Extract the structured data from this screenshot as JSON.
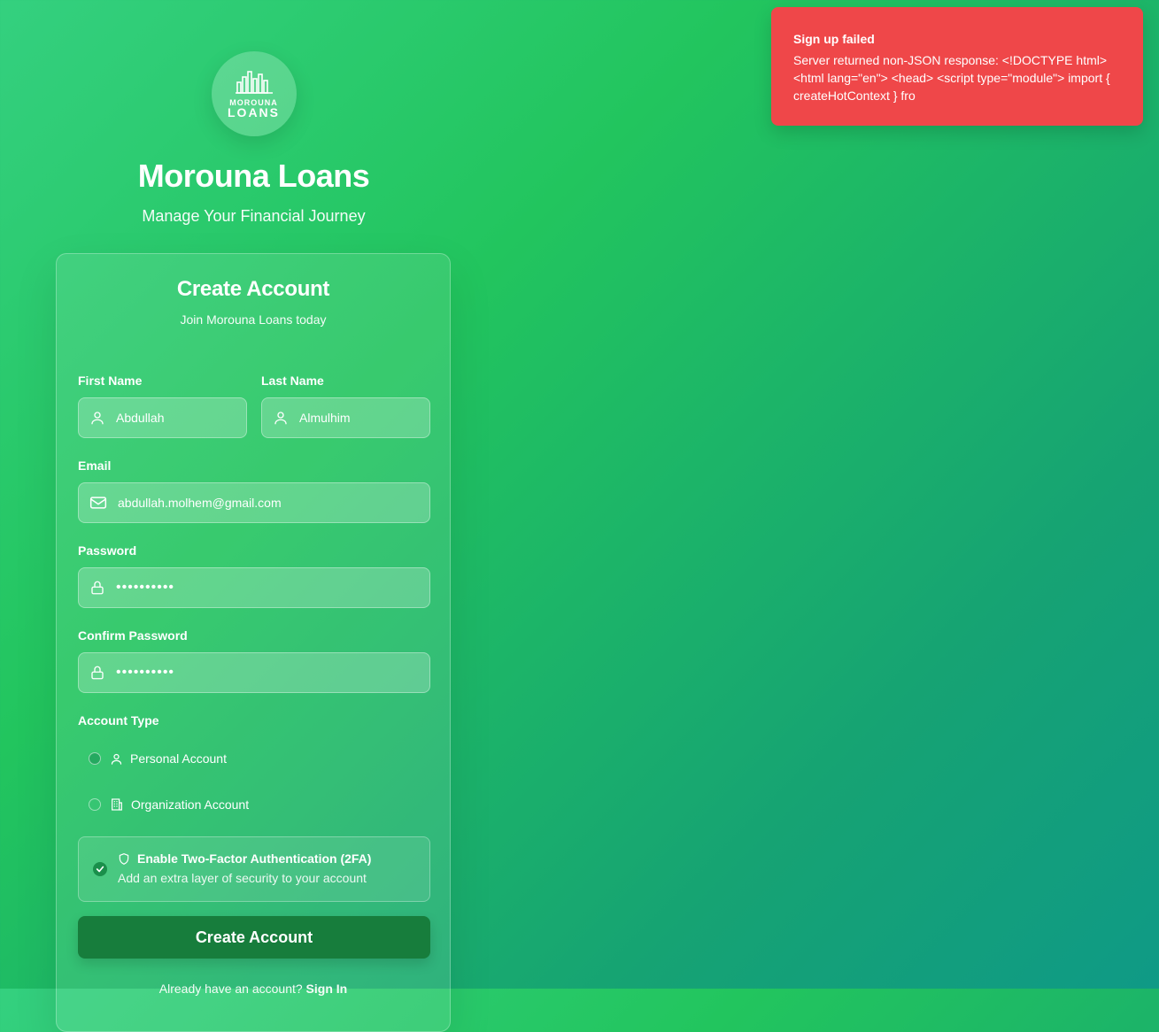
{
  "brand": {
    "logo_top": "MOROUNA",
    "logo_bottom": "LOANS",
    "title": "Morouna Loans",
    "subtitle": "Manage Your Financial Journey"
  },
  "form": {
    "title": "Create Account",
    "subtitle": "Join Morouna Loans today",
    "first_name": {
      "label": "First Name",
      "value": "Abdullah"
    },
    "last_name": {
      "label": "Last Name",
      "value": "Almulhim"
    },
    "email": {
      "label": "Email",
      "value": "abdullah.molhem@gmail.com"
    },
    "password": {
      "label": "Password",
      "value": "••••••••••"
    },
    "confirm_password": {
      "label": "Confirm Password",
      "value": "••••••••••"
    },
    "account_type": {
      "label": "Account Type",
      "options": [
        {
          "label": "Personal Account",
          "icon": "user-icon"
        },
        {
          "label": "Organization Account",
          "icon": "building-icon"
        }
      ]
    },
    "two_factor": {
      "title": "Enable Two-Factor Authentication (2FA)",
      "description": "Add an extra layer of security to your account",
      "checked": true
    },
    "submit_label": "Create Account",
    "signin_prompt": "Already have an account?",
    "signin_link": "Sign In"
  },
  "toast": {
    "title": "Sign up failed",
    "message": "Server returned non-JSON response: <!DOCTYPE html> <html lang=\"en\"> <head> <script type=\"module\"> import { createHotContext } fro",
    "color": "#ef4749"
  }
}
